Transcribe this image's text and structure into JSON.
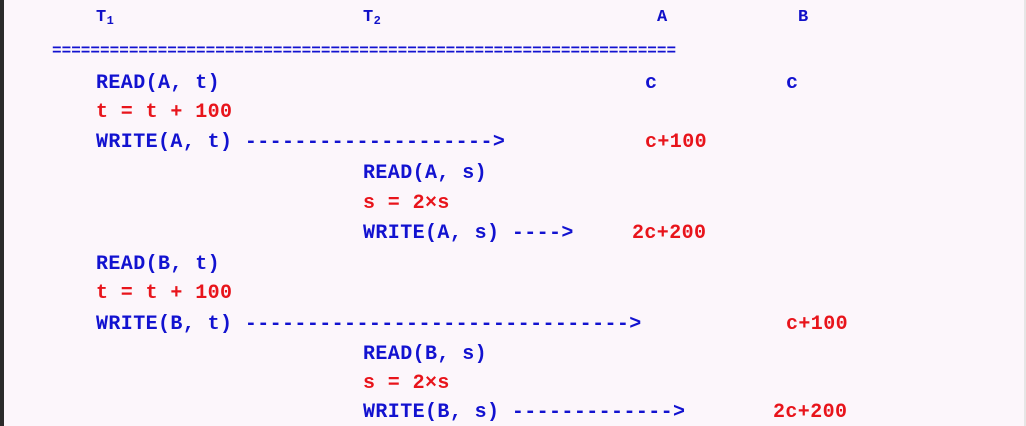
{
  "header": {
    "t1_label": "T",
    "t1_sub": "1",
    "t2_label": "T",
    "t2_sub": "2",
    "col_a": "A",
    "col_b": "B"
  },
  "separator": "=================================================================",
  "rows": [
    {
      "text": "READ(A, t)",
      "color": "blue"
    },
    {
      "text": "t = t + 100",
      "color": "red"
    },
    {
      "text": "WRITE(A, t) -------------------->",
      "color": "blue"
    },
    {
      "text": "READ(A, s)",
      "color": "blue"
    },
    {
      "text": "s = 2×s",
      "color": "red"
    },
    {
      "text": "WRITE(A, s) ---->",
      "color": "blue"
    },
    {
      "text": "READ(B, t)",
      "color": "blue"
    },
    {
      "text": "t = t + 100",
      "color": "red"
    },
    {
      "text": "WRITE(B, t) ------------------------------->",
      "color": "blue"
    },
    {
      "text": "READ(B, s)",
      "color": "blue"
    },
    {
      "text": "s = 2×s",
      "color": "red"
    },
    {
      "text": "WRITE(B, s) ------------->",
      "color": "blue"
    }
  ],
  "values": {
    "a_initial": "c",
    "b_initial": "c",
    "a_after_t1": "c+100",
    "a_after_t2": "2c+200",
    "b_after_t1": "c+100",
    "b_after_t2": "2c+200"
  },
  "colors": {
    "blue": "#1212d0",
    "red": "#e8141b",
    "background": "#fcf6fb"
  }
}
